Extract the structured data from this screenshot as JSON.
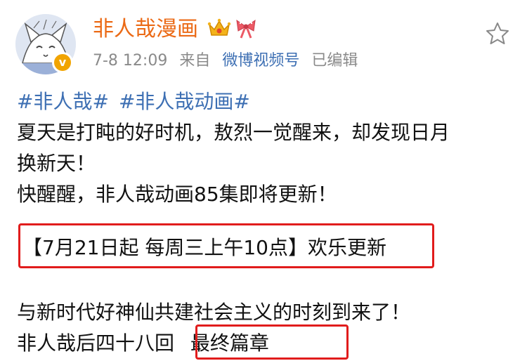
{
  "user": {
    "name": "非人哉漫画",
    "verified_mark": "v"
  },
  "post_meta": {
    "time": "7-8 12:09",
    "from_label": "来自",
    "source": "微博视频号",
    "edited": "已编辑"
  },
  "icons": {
    "crown": "crown-icon",
    "bow": "bow-icon",
    "star": "star-icon"
  },
  "colors": {
    "username": "#eb6a16",
    "topic_link": "#3d6fb3",
    "meta_gray": "#8a8a8a",
    "highlight_box": "#e11c1c"
  },
  "post": {
    "topics": [
      "#非人哉#",
      "#非人哉动画#"
    ],
    "line1": "夏天是打盹的好时机，敖烈一觉醒来，却发现日月",
    "line2": "换新天！",
    "line3": "快醒醒，非人哉动画85集即将更新！",
    "schedule": "【7月21日起 每周三上午10点】欢乐更新",
    "line5": "与新时代好神仙共建社会主义的时刻到来了！",
    "line6_prefix": "非人哉后四十八回",
    "line6_highlight": "最终篇章"
  }
}
